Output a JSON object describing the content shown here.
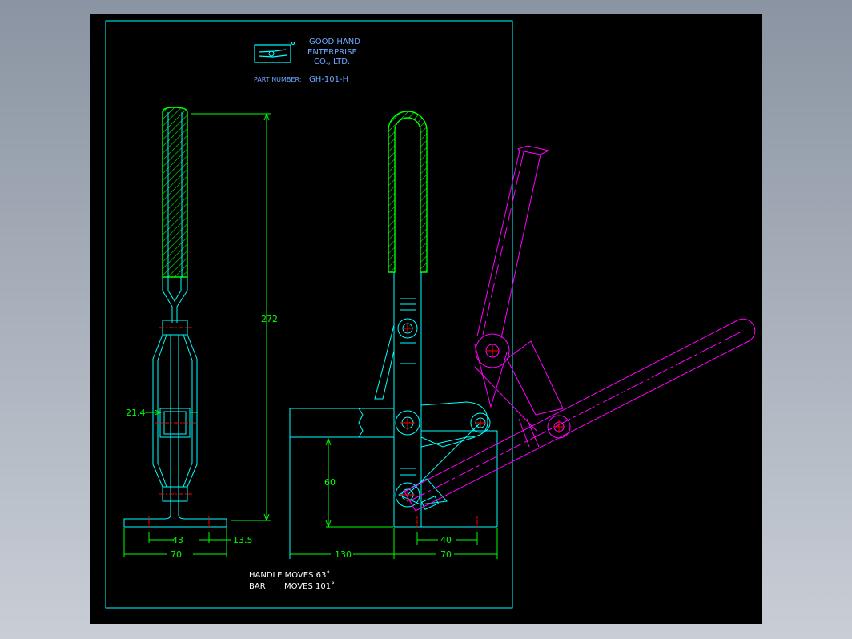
{
  "title_block": {
    "company_line1": "GOOD HAND",
    "company_line2": "ENTERPRISE",
    "company_line3": "CO., LTD.",
    "part_number_label": "PART NUMBER:",
    "part_number": "GH-101-H"
  },
  "dimensions": {
    "overall_height": "272",
    "body_width": "21.4",
    "left_hole_spacing": "43",
    "left_edge_offset": "13.5",
    "left_base_width": "70",
    "arm_height": "60",
    "reach": "130",
    "right_hole_spacing": "40",
    "right_base_width": "70"
  },
  "notes": {
    "line1": "HANDLE MOVES 63˚",
    "line2_a": "BAR",
    "line2_b": "MOVES 101˚"
  },
  "colors": {
    "border": "#00ffff",
    "geometry": "#00ffff",
    "hatch": "#00ff00",
    "dimension": "#00ff00",
    "alt_position": "#ff00ff",
    "center_mark": "#ff0000",
    "text_blue": "#6fa8ff",
    "text_white": "#ffffff"
  }
}
